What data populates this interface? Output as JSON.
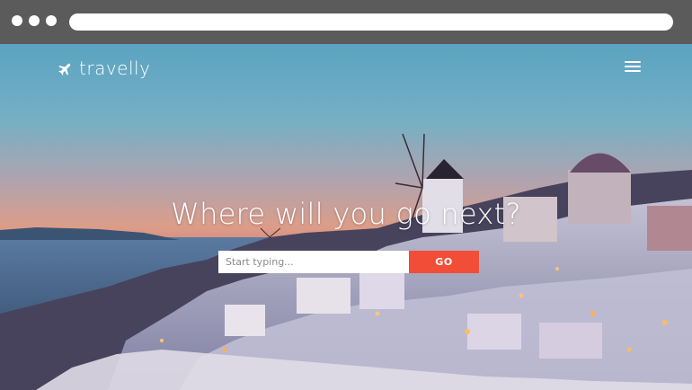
{
  "browser": {
    "window_dots": [
      "close-dot",
      "minimize-dot",
      "maximize-dot"
    ]
  },
  "nav": {
    "logo_text": "travelly",
    "logo_icon": "airplane-icon",
    "menu_icon": "hamburger-menu-icon"
  },
  "hero": {
    "headline": "Where will you go next?",
    "search": {
      "placeholder": "Start typing...",
      "value": "",
      "button_label": "GO"
    }
  },
  "colors": {
    "accent": "#f14d37",
    "chrome": "#5b5b5b"
  }
}
